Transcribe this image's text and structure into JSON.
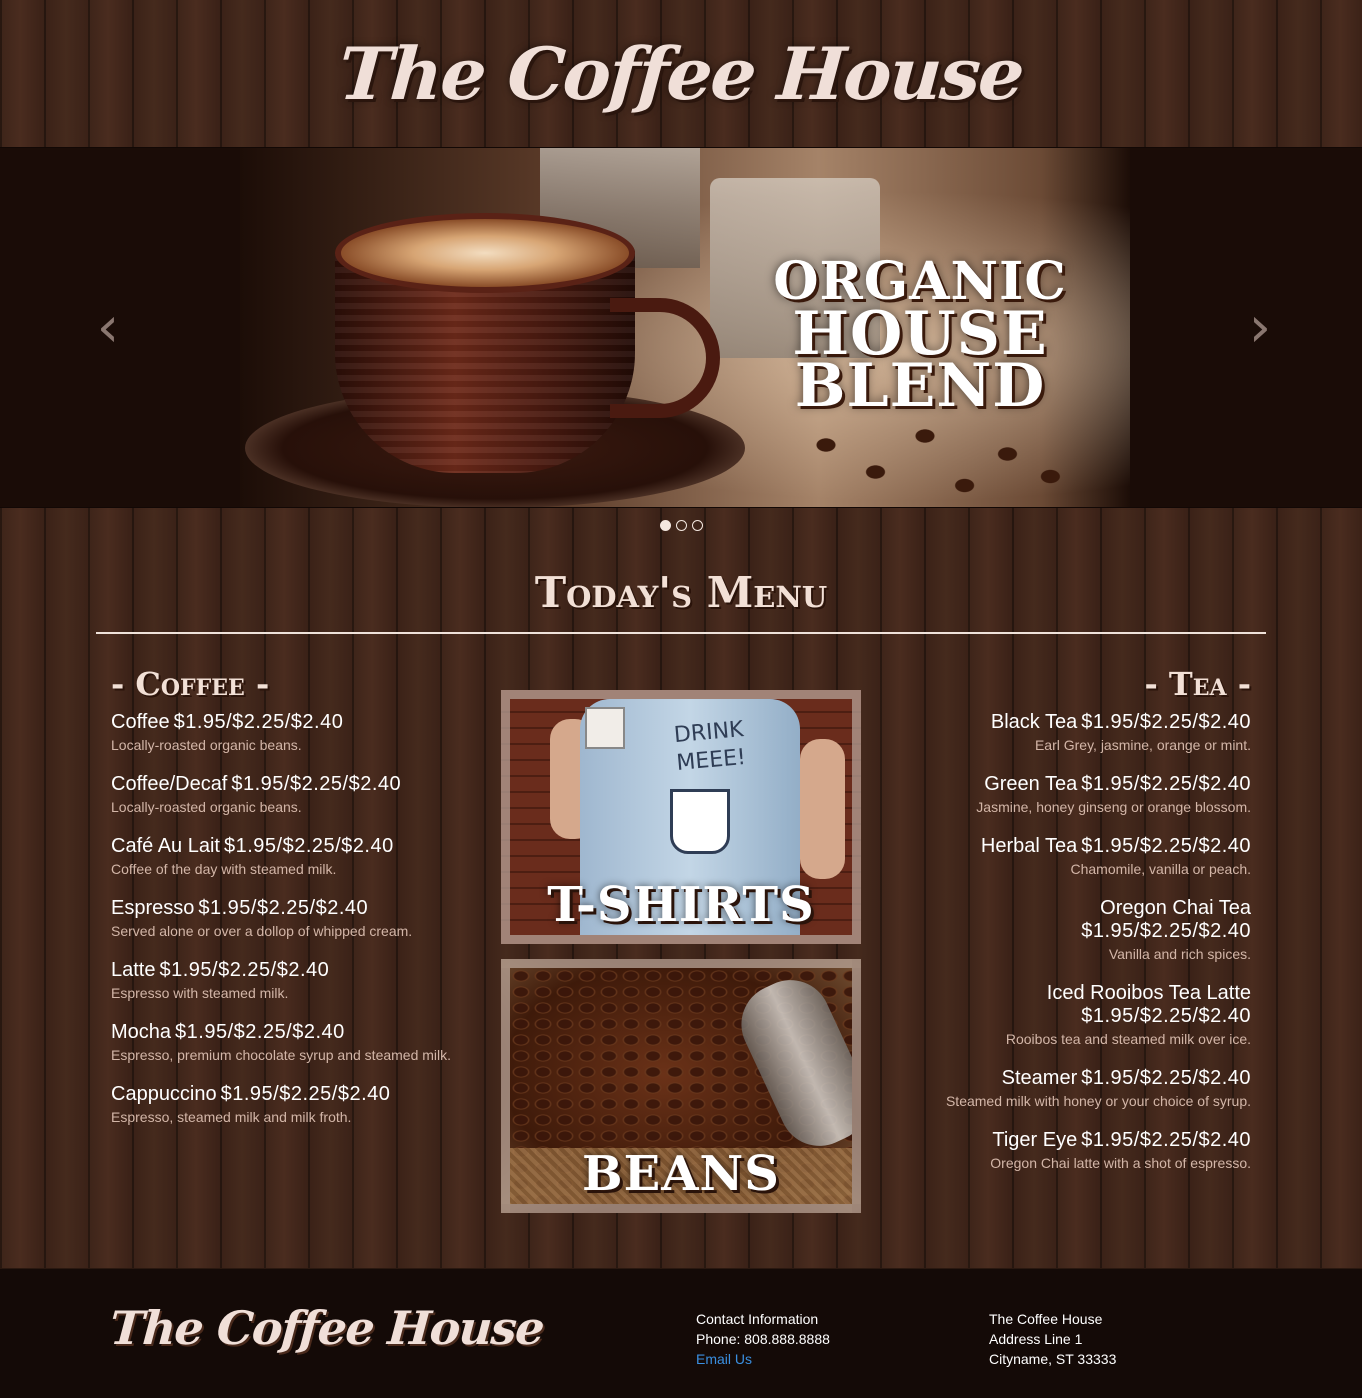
{
  "header": {
    "title": "The Coffee House"
  },
  "carousel": {
    "caption": [
      "ORGANIC",
      "HOUSE",
      "BLEND"
    ],
    "prev_glyph": "‹",
    "next_glyph": "›",
    "slide_count": 3,
    "active_slide": 1
  },
  "menu": {
    "heading": "Today's Menu",
    "coffee": {
      "title": "- Coffee -",
      "items": [
        {
          "name": "Coffee",
          "price": "$1.95/$2.25/$2.40",
          "desc": "Locally-roasted organic beans."
        },
        {
          "name": "Coffee/Decaf",
          "price": "$1.95/$2.25/$2.40",
          "desc": "Locally-roasted organic beans."
        },
        {
          "name": "Café Au Lait",
          "price": "$1.95/$2.25/$2.40",
          "desc": "Coffee of the day with steamed milk."
        },
        {
          "name": "Espresso",
          "price": "$1.95/$2.25/$2.40",
          "desc": "Served alone or over a dollop of whipped cream."
        },
        {
          "name": "Latte",
          "price": "$1.95/$2.25/$2.40",
          "desc": "Espresso with steamed milk."
        },
        {
          "name": "Mocha",
          "price": "$1.95/$2.25/$2.40",
          "desc": "Espresso, premium chocolate syrup and steamed milk."
        },
        {
          "name": "Cappuccino",
          "price": "$1.95/$2.25/$2.40",
          "desc": "Espresso, steamed milk and milk froth."
        }
      ]
    },
    "tea": {
      "title": "- Tea -",
      "items": [
        {
          "name": "Black Tea",
          "price": "$1.95/$2.25/$2.40",
          "desc": "Earl Grey, jasmine, orange or mint."
        },
        {
          "name": "Green Tea",
          "price": "$1.95/$2.25/$2.40",
          "desc": "Jasmine, honey ginseng or orange blossom."
        },
        {
          "name": "Herbal Tea",
          "price": "$1.95/$2.25/$2.40",
          "desc": "Chamomile, vanilla or peach."
        },
        {
          "name": "Oregon Chai Tea",
          "price": "$1.95/$2.25/$2.40",
          "desc": "Vanilla and rich spices."
        },
        {
          "name": "Iced Rooibos Tea Latte",
          "price": "$1.95/$2.25/$2.40",
          "desc": "Rooibos tea and steamed milk over ice."
        },
        {
          "name": "Steamer",
          "price": "$1.95/$2.25/$2.40",
          "desc": "Steamed milk with honey or your choice of syrup."
        },
        {
          "name": "Tiger Eye",
          "price": "$1.95/$2.25/$2.40",
          "desc": "Oregon Chai latte with a shot of espresso."
        }
      ]
    },
    "promos": {
      "shirts": {
        "label": "T-SHIRTS",
        "shirt_text": "DRINK MEEE!"
      },
      "beans": {
        "label": "BEANS"
      }
    }
  },
  "footer": {
    "title": "The Coffee House",
    "contact": {
      "heading": "Contact Information",
      "phone": "Phone: 808.888.8888",
      "email_label": "Email Us"
    },
    "address": {
      "name": "The Coffee House",
      "line1": "Address Line 1",
      "city": "Cityname, ST 33333"
    }
  },
  "colors": {
    "wood": "#3a2218",
    "heading": "#f2e0d6",
    "desc": "#d3b6a8",
    "footer_bg": "#140a07",
    "link": "#3a8fe0"
  }
}
